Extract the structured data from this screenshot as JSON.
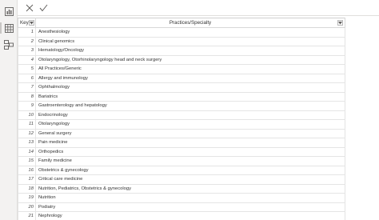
{
  "rail": {
    "items": [
      {
        "name": "report-view-icon",
        "active": false
      },
      {
        "name": "data-view-icon",
        "active": true
      },
      {
        "name": "model-view-icon",
        "active": false
      }
    ]
  },
  "formula_bar": {
    "cancel_icon": "close-icon",
    "commit_icon": "check-icon"
  },
  "table": {
    "columns": [
      "Keys",
      "Practices/Specialty"
    ],
    "rows": [
      {
        "key": "1",
        "value": "Anesthesiology"
      },
      {
        "key": "2",
        "value": "Clinical genomics"
      },
      {
        "key": "3",
        "value": "Hematology/Oncology"
      },
      {
        "key": "4",
        "value": "Otolaryngology, Otorhinolaryngology head and neck surgery"
      },
      {
        "key": "5",
        "value": "All Practices/Generic"
      },
      {
        "key": "6",
        "value": "Allergy and immunology"
      },
      {
        "key": "7",
        "value": "Ophthalmology"
      },
      {
        "key": "8",
        "value": "Bariatrics"
      },
      {
        "key": "9",
        "value": "Gastroenterology and hepatology"
      },
      {
        "key": "10",
        "value": "Endocrinology"
      },
      {
        "key": "11",
        "value": "Otolaryngology"
      },
      {
        "key": "12",
        "value": "General surgery"
      },
      {
        "key": "13",
        "value": "Pain medicine"
      },
      {
        "key": "14",
        "value": "Orthopedics"
      },
      {
        "key": "15",
        "value": "Family medicine"
      },
      {
        "key": "16",
        "value": "Obstetrics & gynecology"
      },
      {
        "key": "17",
        "value": "Critical care medicine"
      },
      {
        "key": "18",
        "value": "Nutrition, Pediatrics, Obstetrics & gynecology"
      },
      {
        "key": "19",
        "value": "Nutrition"
      },
      {
        "key": "20",
        "value": "Podiatry"
      },
      {
        "key": "21",
        "value": "Nephrology"
      }
    ]
  }
}
